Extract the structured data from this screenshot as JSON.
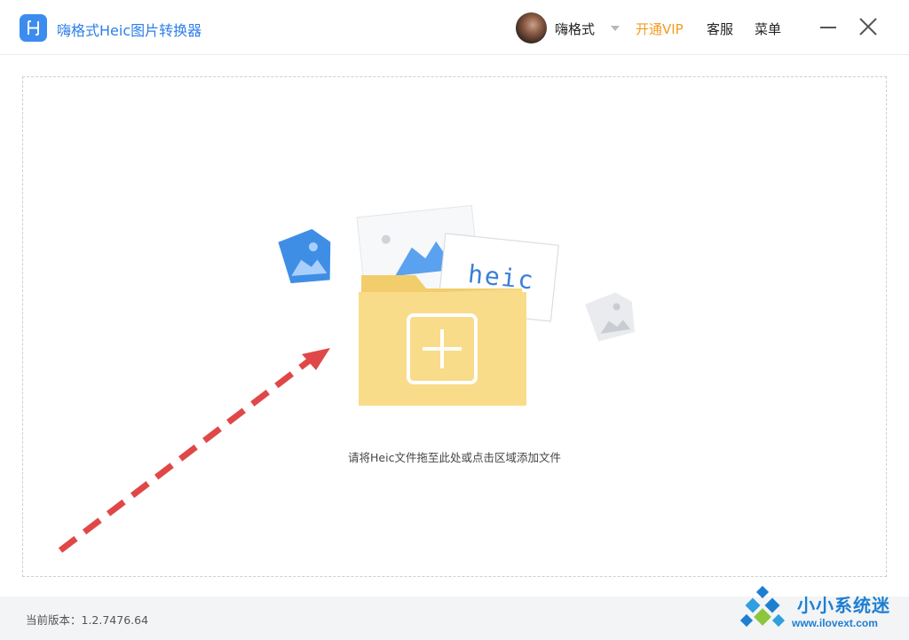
{
  "titlebar": {
    "app_title": "嗨格式Heic图片转换器",
    "username": "嗨格式",
    "vip_label": "开通VIP",
    "service_label": "客服",
    "menu_label": "菜单"
  },
  "drop_zone": {
    "badge_text": "heic",
    "hint": "请将Heic文件拖至此处或点击区域添加文件"
  },
  "footer": {
    "version_label": "当前版本：1.2.7476.64"
  },
  "watermark": {
    "title": "小小系统迷",
    "url": "www.ilovext.com"
  },
  "colors": {
    "brand_blue": "#3c8cf0",
    "vip_orange": "#f29b1e",
    "folder_yellow": "#f7d97c",
    "arrow_red": "#e04848"
  },
  "icons": [
    "app-logo-icon",
    "chevron-down-icon",
    "minimize-icon",
    "close-icon",
    "folder-add-icon",
    "image-icon"
  ]
}
